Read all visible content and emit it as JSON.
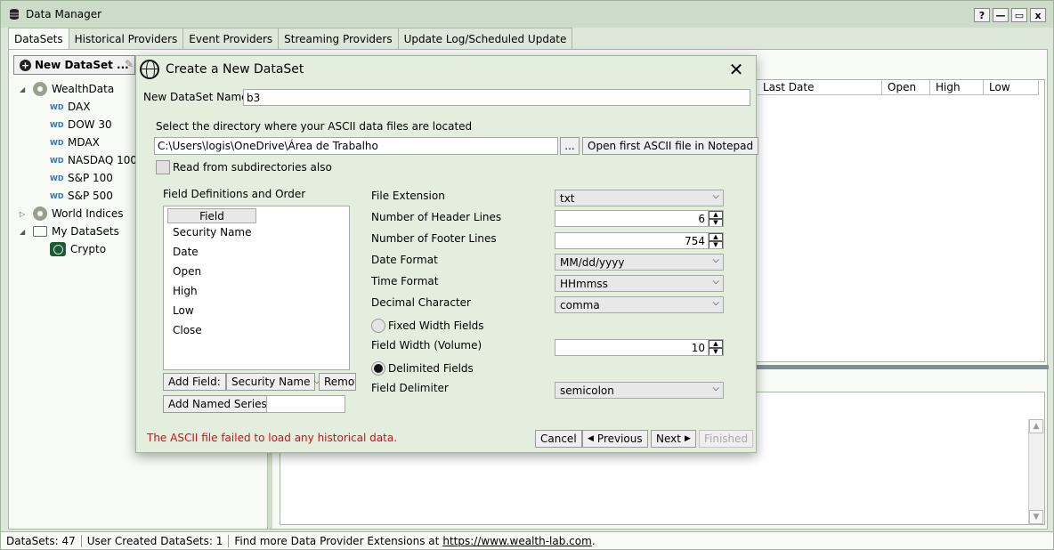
{
  "window": {
    "title": "Data Manager",
    "controls": [
      "?",
      "—",
      "▭",
      "x"
    ]
  },
  "tabs": [
    "DataSets",
    "Historical Providers",
    "Event Providers",
    "Streaming Providers",
    "Update Log/Scheduled Update"
  ],
  "toolbar": {
    "new_dataset_label": "New DataSet ..."
  },
  "tree": {
    "wealthdata": "WealthData",
    "wealthdata_items": [
      "DAX",
      "DOW 30",
      "MDAX",
      "NASDAQ 100",
      "S&P 100",
      "S&P 500"
    ],
    "wd_badge": "WD",
    "world_indices": "World Indices",
    "my_datasets": "My DataSets",
    "crypto": "Crypto"
  },
  "grid": {
    "columns": [
      "Last Date",
      "Open",
      "High",
      "Low"
    ]
  },
  "status": {
    "datasets": "DataSets: 47",
    "user_created": "User Created DataSets: 1",
    "find_more": "Find more Data Provider Extensions at",
    "link": "https://www.wealth-lab.com",
    "period": "."
  },
  "dialog": {
    "title": "Create a New DataSet",
    "name_label": "New DataSet Name:",
    "name_value": "b3",
    "dir_label": "Select the directory where your ASCII data files are located",
    "dir_value": "C:\\Users\\logis\\OneDrive\\Área de Trabalho",
    "browse_label": "...",
    "notepad_label": "Open first ASCII file in Notepad",
    "subdirs_label": "Read from subdirectories also",
    "field_defs_label": "Field Definitions and Order",
    "field_header": "Field",
    "fields": [
      "Security Name",
      "Date",
      "Open",
      "High",
      "Low",
      "Close"
    ],
    "add_field_label": "Add Field:",
    "add_field_select": "Security Name",
    "remove_label": "Remov",
    "add_named_label": "Add Named Series:",
    "file_ext_label": "File Extension",
    "file_ext_value": "txt",
    "header_lines_label": "Number of Header Lines",
    "header_lines_value": "6",
    "footer_lines_label": "Number of Footer Lines",
    "footer_lines_value": "754",
    "date_format_label": "Date Format",
    "date_format_value": "MM/dd/yyyy",
    "time_format_label": "Time Format",
    "time_format_value": "HHmmss",
    "decimal_label": "Decimal Character",
    "decimal_value": "comma",
    "fixed_width_label": "Fixed Width Fields",
    "field_width_label": "Field Width (Volume)",
    "field_width_value": "10",
    "delimited_label": "Delimited Fields",
    "delimiter_label": "Field Delimiter",
    "delimiter_value": "semicolon",
    "error_text": "The ASCII file failed to load any historical data.",
    "cancel_label": "Cancel",
    "previous_label": "Previous",
    "next_label": "Next",
    "finished_label": "Finished",
    "error_color": "#d01010"
  }
}
